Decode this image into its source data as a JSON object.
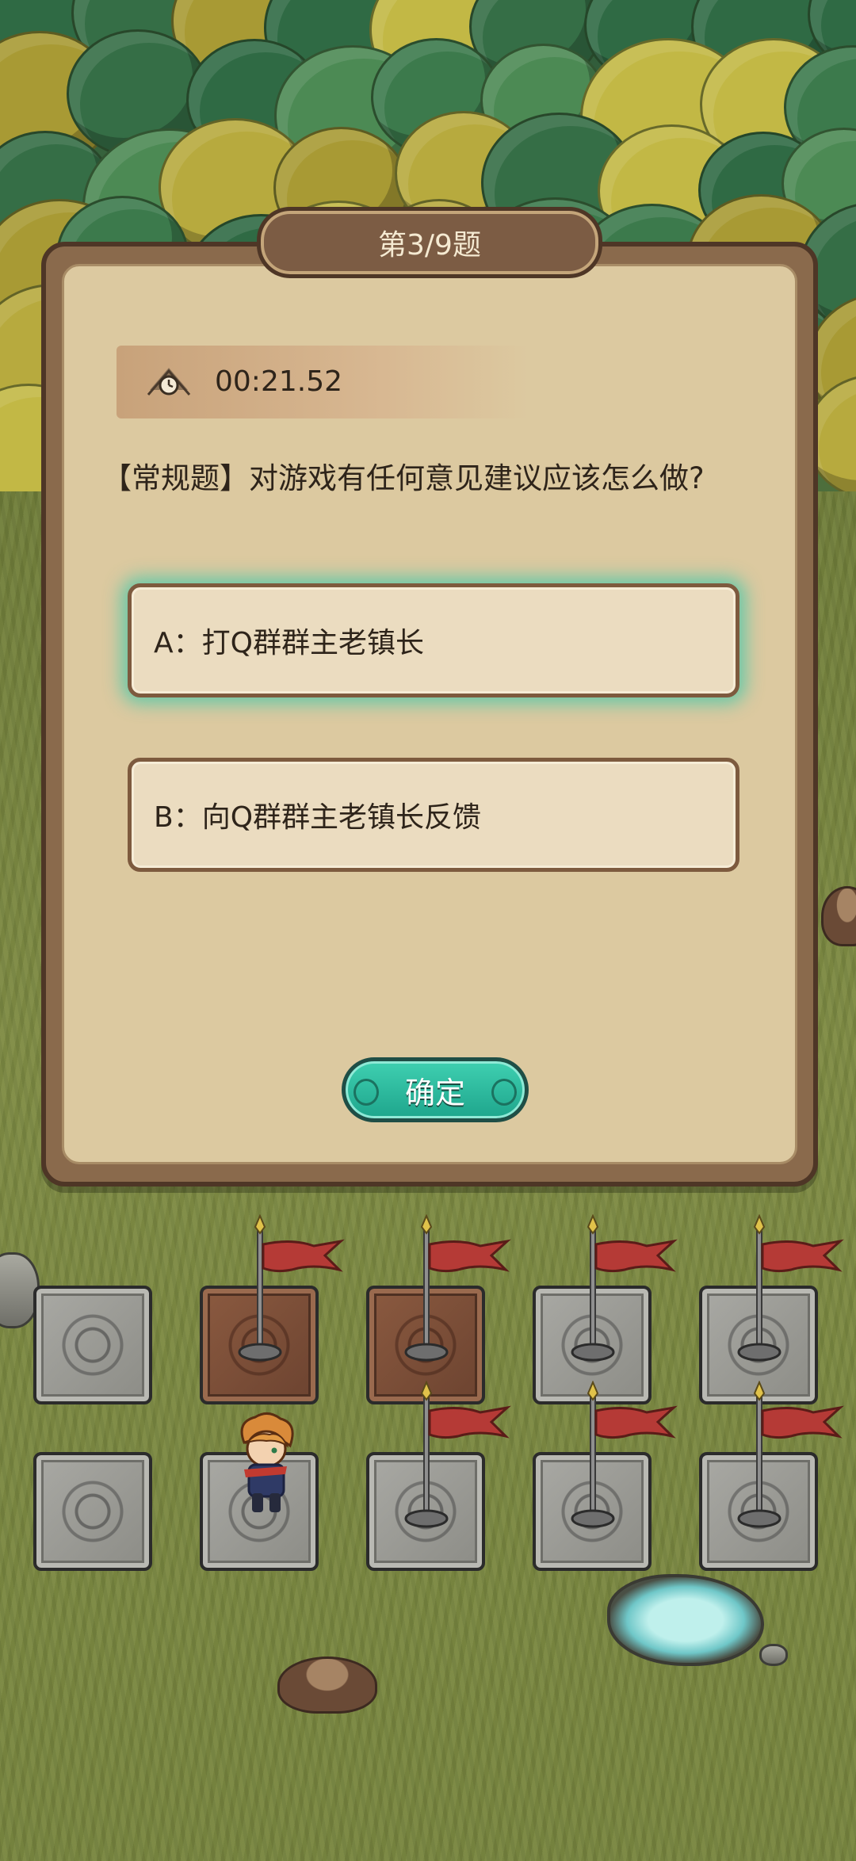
{
  "quiz": {
    "title": "第3/9题",
    "timer": "00:21.52",
    "question": "【常规题】对游戏有任何意见建议应该怎么做?",
    "options": [
      {
        "label": "A：打Q群群主老镇长",
        "selected": true
      },
      {
        "label": "B：向Q群群主老镇长反馈",
        "selected": false
      }
    ],
    "confirm_label": "确定"
  },
  "board": {
    "rows": [
      [
        {
          "tile": "stone",
          "flag": false
        },
        {
          "tile": "visited",
          "flag": true
        },
        {
          "tile": "visited",
          "flag": true
        },
        {
          "tile": "stone",
          "flag": true
        },
        {
          "tile": "stone",
          "flag": true
        }
      ],
      [
        {
          "tile": "stone",
          "flag": false
        },
        {
          "tile": "stone",
          "flag": false,
          "hero": true
        },
        {
          "tile": "stone",
          "flag": true
        },
        {
          "tile": "stone",
          "flag": true
        },
        {
          "tile": "stone",
          "flag": true
        }
      ]
    ]
  },
  "colors": {
    "selected_glow": "#40c8aa",
    "confirm_button": "#2dbf9f",
    "flag_red": "#b53a36",
    "panel_bg": "#dcc9a0"
  },
  "icons": {
    "timer": "clock-icon",
    "flag": "flag-icon"
  }
}
